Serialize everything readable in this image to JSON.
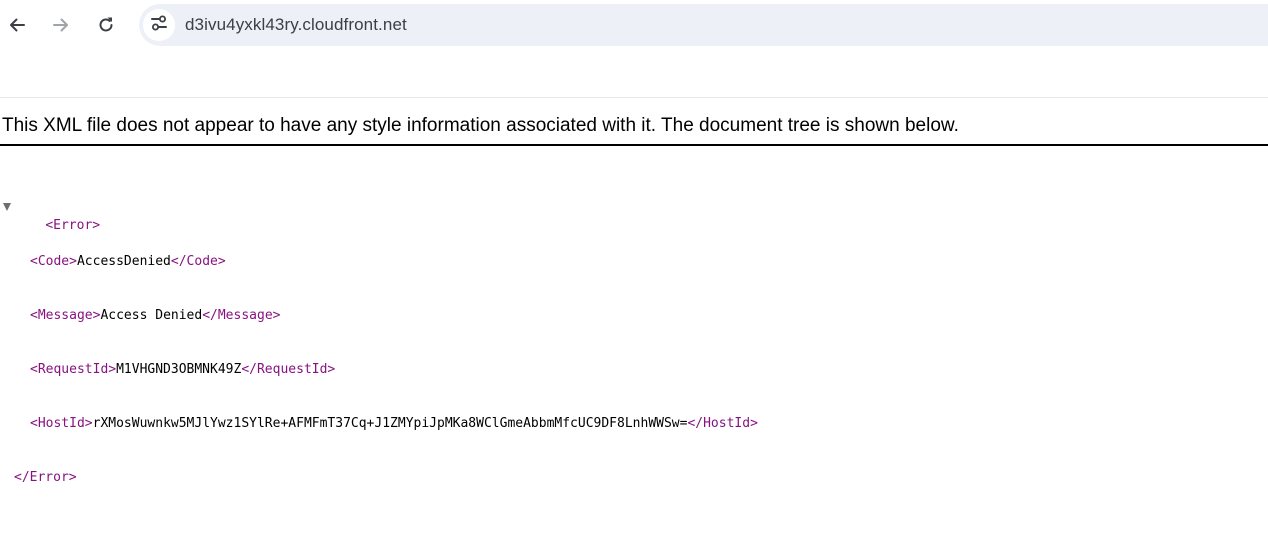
{
  "toolbar": {
    "back_icon": "arrow-left-icon",
    "forward_icon": "arrow-right-icon",
    "reload_icon": "reload-icon",
    "site_info_icon": "tune-icon",
    "url": "d3ivu4yxkl43ry.cloudfront.net"
  },
  "xml_viewer": {
    "header": "This XML file does not appear to have any style information associated with it. The document tree is shown below.",
    "root_open": "<Error>",
    "root_close": "</Error>",
    "elements": [
      {
        "open": "<Code>",
        "value": "AccessDenied",
        "close": "</Code>"
      },
      {
        "open": "<Message>",
        "value": "Access Denied",
        "close": "</Message>"
      },
      {
        "open": "<RequestId>",
        "value": "M1VHGND3OBMNK49Z",
        "close": "</RequestId>"
      },
      {
        "open": "<HostId>",
        "value": "rXMosWuwnkw5MJlYwz1SYlRe+AFMFmT37Cq+J1ZMYpiJpMKa8WClGmeAbbmMfcUC9DF8LnhWWSw=",
        "close": "</HostId>"
      }
    ]
  },
  "colors": {
    "tag": "#881280",
    "omnibox_bg": "#edf0f7",
    "url_text": "#3c4043"
  }
}
